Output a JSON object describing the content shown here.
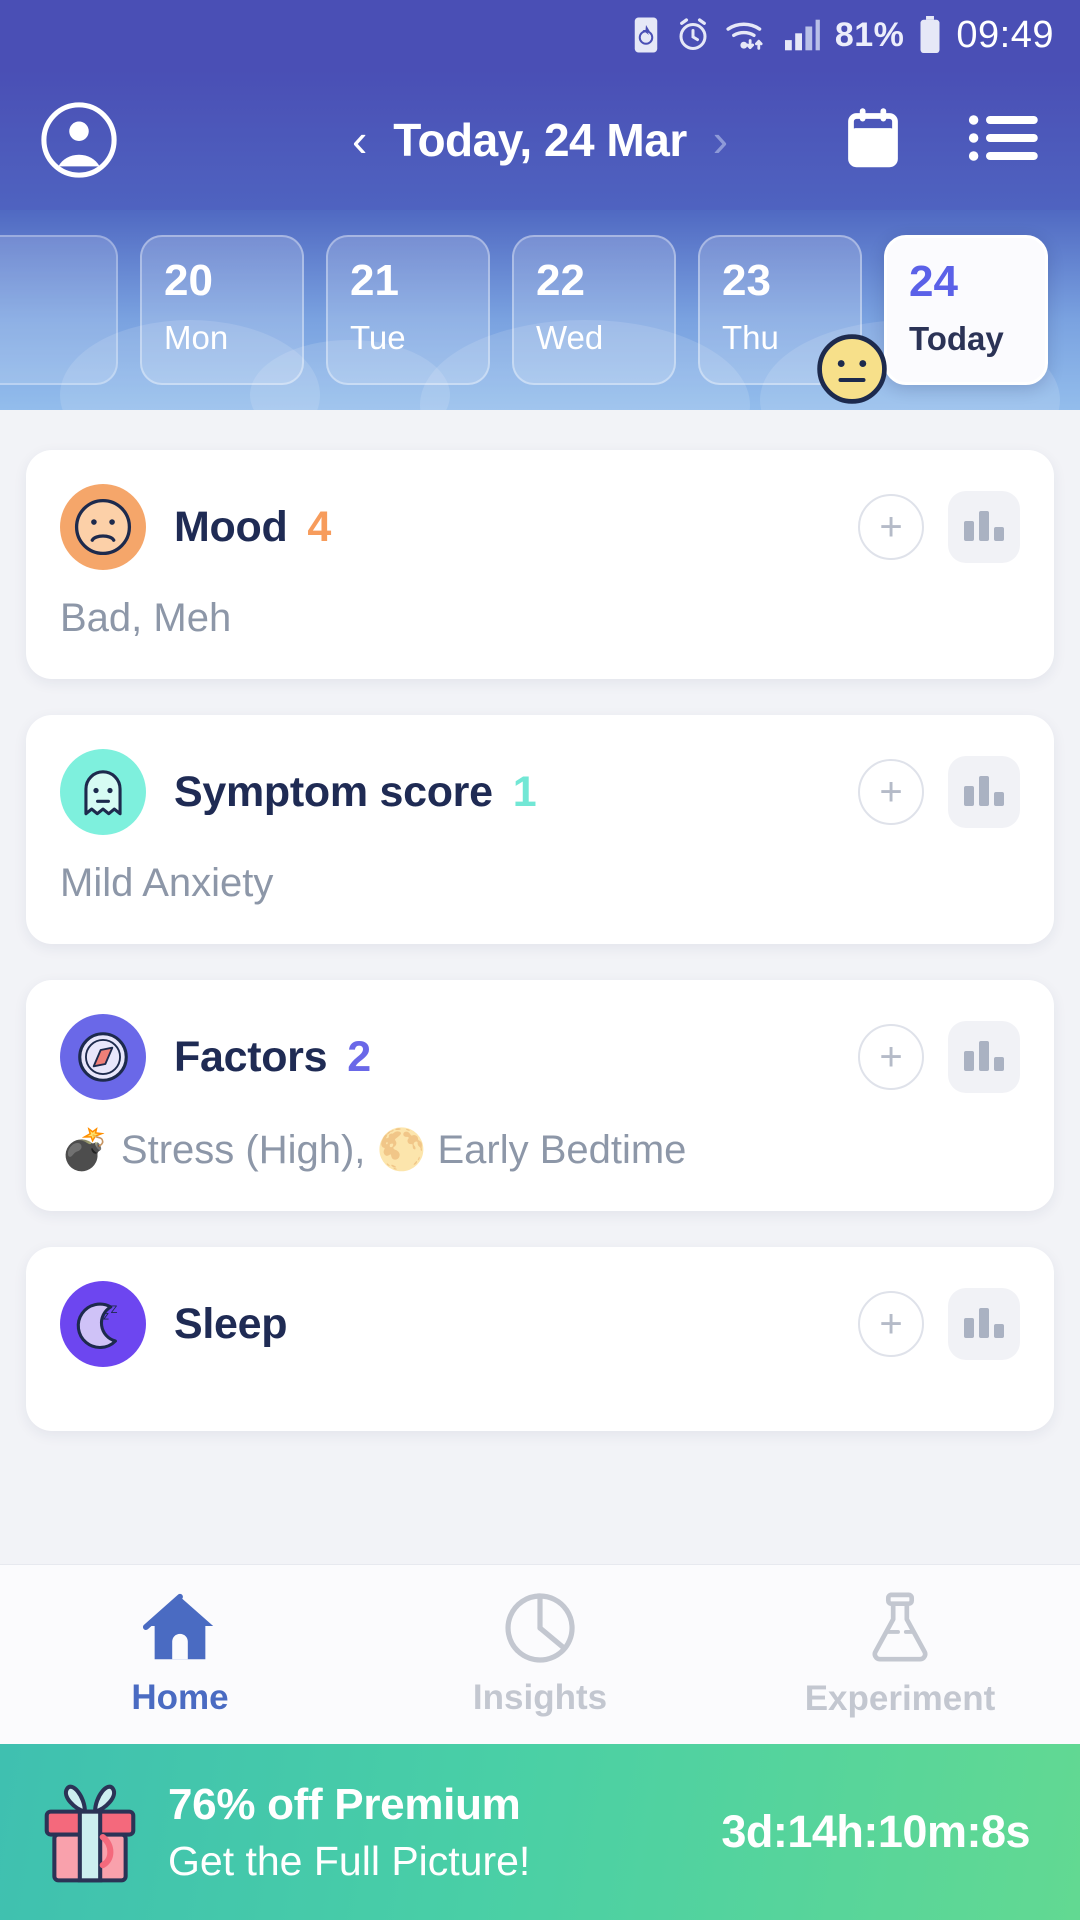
{
  "status_bar": {
    "icons": [
      "battery-saver-icon",
      "alarm-icon",
      "wifi-icon",
      "signal-icon"
    ],
    "battery_percent": "81%",
    "clock": "09:49"
  },
  "header": {
    "avatar_icon": "profile-avatar-icon",
    "prev_arrow": "‹",
    "date_title": "Today, 24 Mar",
    "next_arrow": "›",
    "calendar_icon": "calendar-icon",
    "menu_icon": "list-menu-icon"
  },
  "date_strip": {
    "days": [
      {
        "num": "20",
        "name": "Mon",
        "today": false,
        "emoji": ""
      },
      {
        "num": "21",
        "name": "Tue",
        "today": false,
        "emoji": ""
      },
      {
        "num": "22",
        "name": "Wed",
        "today": false,
        "emoji": ""
      },
      {
        "num": "23",
        "name": "Thu",
        "today": false,
        "emoji": "neutral-face-emoji"
      },
      {
        "num": "24",
        "name": "Today",
        "today": true,
        "emoji": ""
      }
    ]
  },
  "cards": [
    {
      "icon": "sad-face-icon",
      "icon_bg": "#f5a66a",
      "title": "Mood",
      "value": "4",
      "value_color": "#f79c5c",
      "subtitle": "Bad, Meh",
      "add_label": "+",
      "chart_label": "chart-icon"
    },
    {
      "icon": "ghost-icon",
      "icon_bg": "#7ef0dd",
      "title": "Symptom score",
      "value": "1",
      "value_color": "#72e7d5",
      "subtitle": "Mild Anxiety",
      "add_label": "+",
      "chart_label": "chart-icon"
    },
    {
      "icon": "compass-icon",
      "icon_bg": "#6a68e8",
      "title": "Factors",
      "value": "2",
      "value_color": "#6a68e8",
      "subtitle": "💣 Stress (High), 🌕 Early Bedtime",
      "add_label": "+",
      "chart_label": "chart-icon"
    },
    {
      "icon": "sleep-moon-icon",
      "icon_bg": "#6d46f0",
      "title": "Sleep",
      "value": "",
      "value_color": "#6d46f0",
      "subtitle": "",
      "add_label": "+",
      "chart_label": "chart-icon"
    }
  ],
  "bottom_nav": {
    "items": [
      {
        "label": "Home",
        "icon": "home-icon",
        "active": true
      },
      {
        "label": "Insights",
        "icon": "pie-chart-icon",
        "active": false
      },
      {
        "label": "Experiment",
        "icon": "flask-icon",
        "active": false
      }
    ]
  },
  "promo": {
    "gift_icon": "gift-box-icon",
    "title": "76% off Premium",
    "subtitle": "Get the Full Picture!",
    "timer": "3d:14h:10m:8s"
  },
  "colors": {
    "header_blue": "#4a4fb5",
    "accent_purple": "#5b61e8",
    "nav_active": "#4a6bc2",
    "promo_green": "#49cfa6"
  }
}
